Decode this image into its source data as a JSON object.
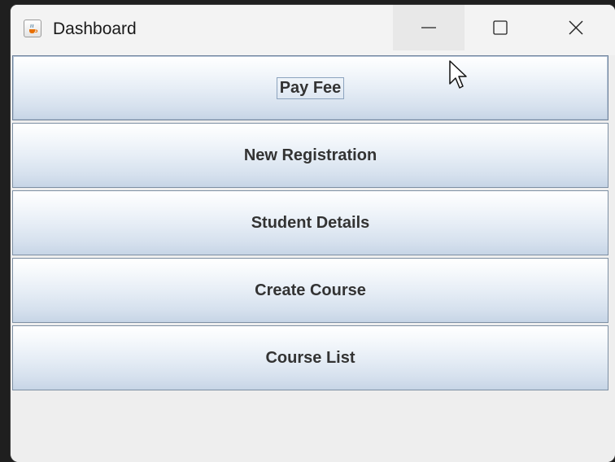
{
  "window": {
    "title": "Dashboard",
    "controls": {
      "minimize_icon": "minimize-icon",
      "maximize_icon": "maximize-icon",
      "close_icon": "close-icon"
    },
    "app_icon": "java-coffee-cup-icon"
  },
  "dashboard": {
    "buttons": [
      {
        "label": "Pay Fee",
        "focused": true
      },
      {
        "label": "New Registration",
        "focused": false
      },
      {
        "label": "Student Details",
        "focused": false
      },
      {
        "label": "Create Course",
        "focused": false
      },
      {
        "label": "Course List",
        "focused": false
      }
    ]
  },
  "colors": {
    "button_border": "#7d8fa3",
    "button_gradient_top": "#ffffff",
    "button_gradient_bottom": "#c7d5e6",
    "button_text": "#333333",
    "window_background": "#eeeeee"
  }
}
